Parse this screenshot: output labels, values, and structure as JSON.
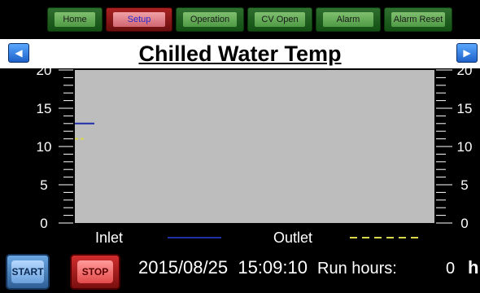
{
  "nav": {
    "buttons": [
      {
        "label": "Home",
        "active": false
      },
      {
        "label": "Setup",
        "active": true
      },
      {
        "label": "Operation",
        "active": false
      },
      {
        "label": "CV Open",
        "active": false
      },
      {
        "label": "Alarm",
        "active": false
      },
      {
        "label": "Alarm Reset",
        "active": false
      }
    ]
  },
  "header": {
    "title": "Chilled Water Temp",
    "prev_icon": "left-arrow-icon",
    "next_icon": "right-arrow-icon"
  },
  "chart_data": {
    "type": "line",
    "ylim": [
      0,
      20
    ],
    "yticks": [
      "20",
      "15",
      "10",
      "5",
      "0"
    ],
    "grid": false,
    "plot_background": "#BDBDBD",
    "series": [
      {
        "name": "Inlet",
        "color": "#1f2fa8",
        "style": "solid",
        "values": [
          13
        ]
      },
      {
        "name": "Outlet",
        "color": "#d8d84a",
        "style": "dashed",
        "values": [
          11
        ]
      }
    ],
    "legend_position": "bottom"
  },
  "footer": {
    "start_label": "START",
    "stop_label": "STOP",
    "datetime": "2015/08/25  15:09:10",
    "run_hours_label": "Run hours:",
    "run_hours_value": "0",
    "run_hours_unit": "h"
  }
}
